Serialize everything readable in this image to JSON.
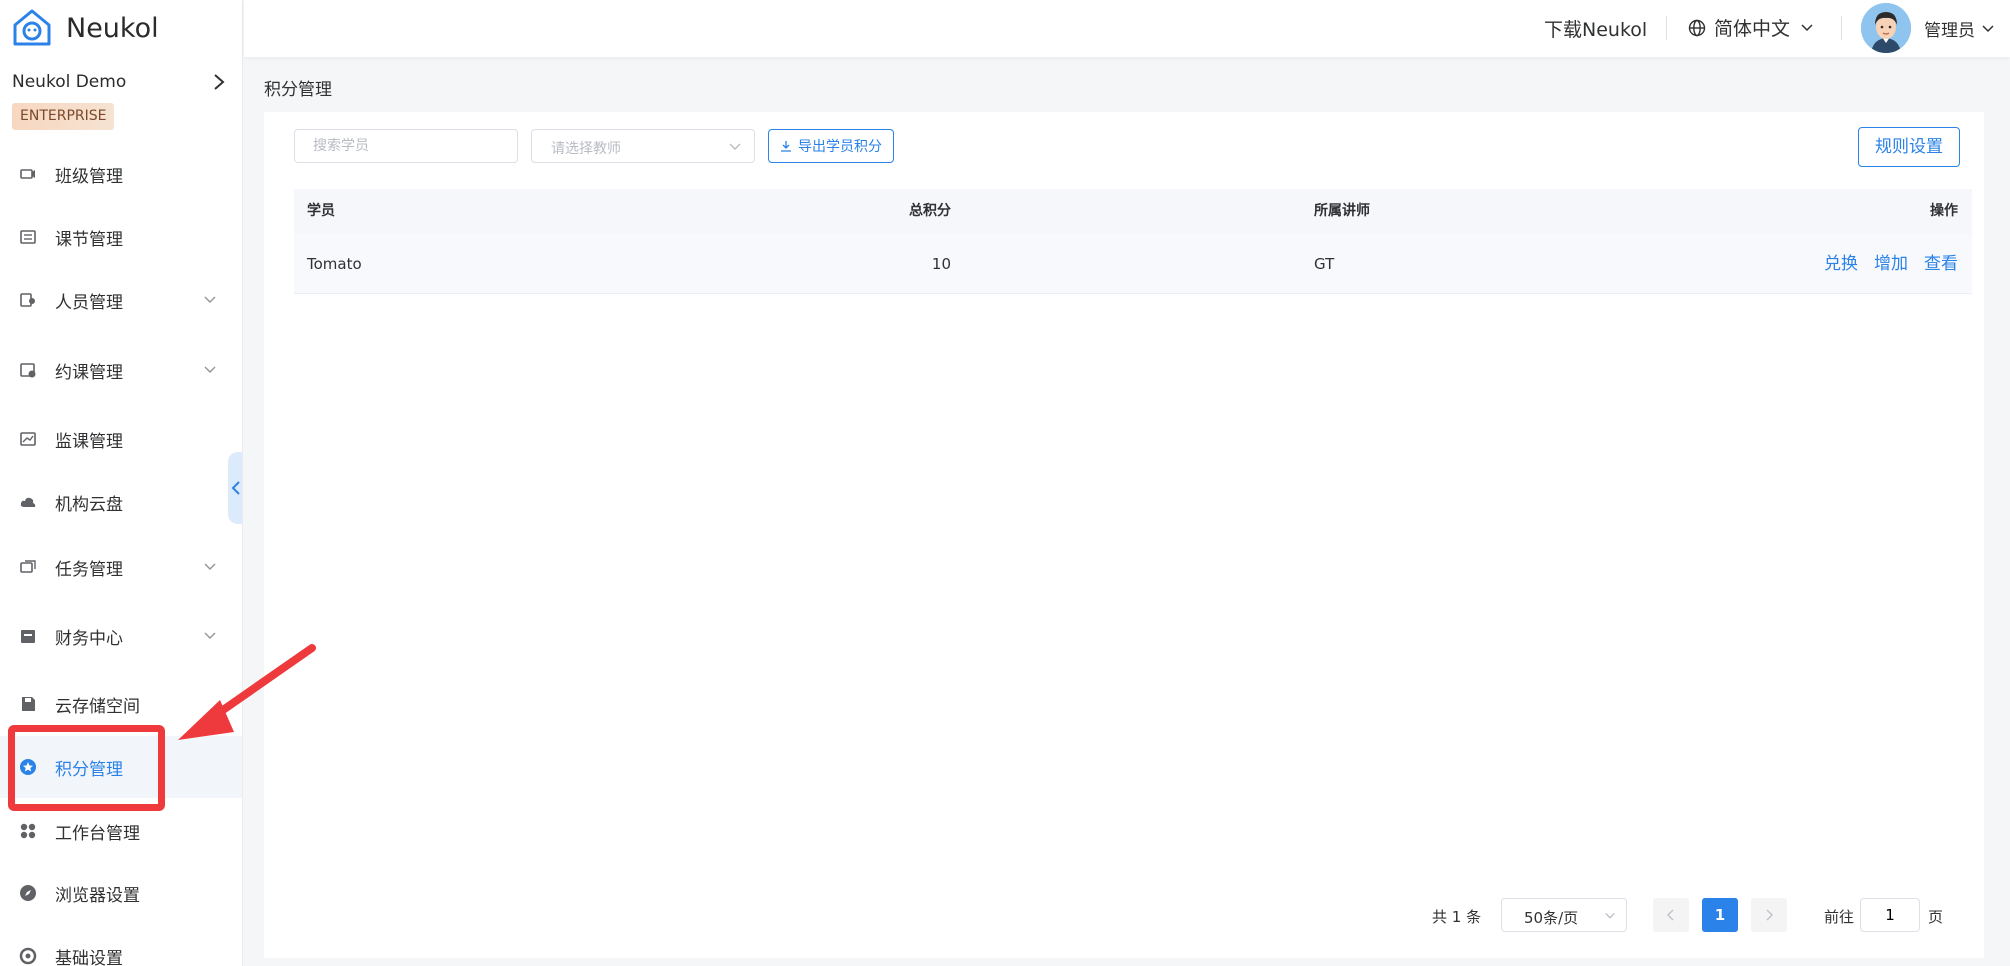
{
  "brand": {
    "name": "Neukol"
  },
  "org": {
    "name": "Neukol Demo",
    "badge": "ENTERPRISE"
  },
  "menu": [
    {
      "label": "班级管理",
      "icon": "class-icon",
      "has_arrow": false,
      "active": false
    },
    {
      "label": "课节管理",
      "icon": "lesson-list-icon",
      "has_arrow": false,
      "active": false
    },
    {
      "label": "人员管理",
      "icon": "people-icon",
      "has_arrow": true,
      "active": false
    },
    {
      "label": "约课管理",
      "icon": "booking-icon",
      "has_arrow": true,
      "active": false
    },
    {
      "label": "监课管理",
      "icon": "monitor-icon",
      "has_arrow": false,
      "active": false
    },
    {
      "label": "机构云盘",
      "icon": "cloud-icon",
      "has_arrow": false,
      "active": false
    },
    {
      "label": "任务管理",
      "icon": "task-icon",
      "has_arrow": true,
      "active": false
    },
    {
      "label": "财务中心",
      "icon": "finance-icon",
      "has_arrow": true,
      "active": false
    },
    {
      "label": "云存储空间",
      "icon": "storage-icon",
      "has_arrow": false,
      "active": false
    },
    {
      "label": "积分管理",
      "icon": "points-star-icon",
      "has_arrow": false,
      "active": true
    },
    {
      "label": "工作台管理",
      "icon": "workbench-icon",
      "has_arrow": false,
      "active": false
    },
    {
      "label": "浏览器设置",
      "icon": "compass-icon",
      "has_arrow": false,
      "active": false
    },
    {
      "label": "基础设置",
      "icon": "settings-icon",
      "has_arrow": false,
      "active": false
    }
  ],
  "header": {
    "download": "下载Neukol",
    "language": "简体中文",
    "user": "管理员"
  },
  "page": {
    "title": "积分管理"
  },
  "toolbar": {
    "search_placeholder": "搜索学员",
    "teacher_placeholder": "请选择教师",
    "export_label": "导出学员积分",
    "rules_label": "规则设置"
  },
  "table": {
    "columns": [
      "学员",
      "总积分",
      "所属讲师",
      "操作"
    ],
    "rows": [
      {
        "student": "Tomato",
        "points": "10",
        "teacher": "GT",
        "actions": [
          "兑换",
          "增加",
          "查看"
        ]
      }
    ]
  },
  "pagination": {
    "total": "共 1 条",
    "page_size": "50条/页",
    "current": "1",
    "goto_label": "前往",
    "goto_value": "1",
    "page_suffix": "页"
  },
  "colors": {
    "accent": "#2b82e8",
    "highlight": "#ee3a3c"
  }
}
